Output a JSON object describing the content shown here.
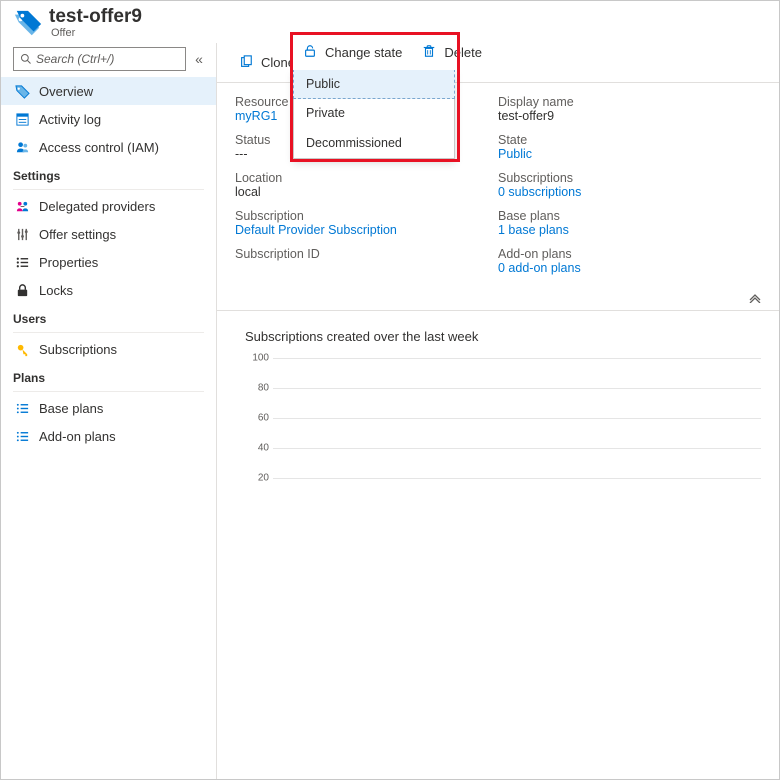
{
  "header": {
    "title": "test-offer9",
    "subtitle": "Offer"
  },
  "search": {
    "placeholder": "Search (Ctrl+/)"
  },
  "nav": {
    "overview": "Overview",
    "activity": "Activity log",
    "iam": "Access control (IAM)",
    "settings_header": "Settings",
    "delegated": "Delegated providers",
    "offer_settings": "Offer settings",
    "properties": "Properties",
    "locks": "Locks",
    "users_header": "Users",
    "subscriptions": "Subscriptions",
    "plans_header": "Plans",
    "base_plans": "Base plans",
    "addon_plans": "Add-on plans"
  },
  "toolbar": {
    "clone": "Clone",
    "change_state": "Change state",
    "delete": "Delete"
  },
  "change_state_menu": {
    "public": "Public",
    "private": "Private",
    "decommissioned": "Decommissioned"
  },
  "details": {
    "left": {
      "rg_label": "Resource group",
      "rg_value": "myRG1",
      "status_label": "Status",
      "status_value": "---",
      "location_label": "Location",
      "location_value": "local",
      "subscription_label": "Subscription",
      "subscription_value": "Default Provider Subscription",
      "sub_id_label": "Subscription ID"
    },
    "right": {
      "display_label": "Display name",
      "display_value": "test-offer9",
      "state_label": "State",
      "state_value": "Public",
      "subs_label": "Subscriptions",
      "subs_value": "0 subscriptions",
      "base_label": "Base plans",
      "base_value": "1 base plans",
      "addon_label": "Add-on plans",
      "addon_value": "0 add-on plans"
    }
  },
  "chart": {
    "title": "Subscriptions created over the last week"
  },
  "chart_data": {
    "type": "bar",
    "title": "Subscriptions created over the last week",
    "categories": [],
    "values": [],
    "ylim": [
      0,
      100
    ],
    "yticks": [
      20,
      40,
      60,
      80,
      100
    ],
    "xlabel": "",
    "ylabel": ""
  }
}
